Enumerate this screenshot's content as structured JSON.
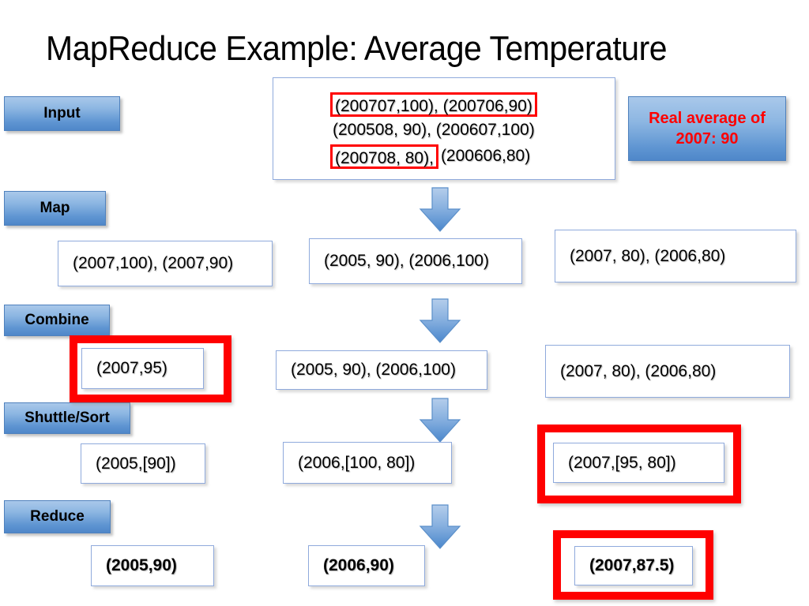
{
  "title": "MapReduce Example: Average Temperature",
  "callout": {
    "line1": "Real average of",
    "line2": "2007: 90",
    "text_color": "#ff0000",
    "fill_top": "#a9c8ea",
    "fill_bottom": "#4f87c9"
  },
  "stages": [
    {
      "id": "input",
      "label": "Input"
    },
    {
      "id": "map",
      "label": "Map"
    },
    {
      "id": "combine",
      "label": "Combine"
    },
    {
      "id": "shuttle_sort",
      "label": "Shuttle/Sort"
    },
    {
      "id": "reduce",
      "label": "Reduce"
    }
  ],
  "input_box": {
    "line1_highlighted": "(200707,100), (200706,90)",
    "line2": "(200508, 90), (200607,100)",
    "line3_highlighted": "(200708, 80),",
    "line3_rest": "(200606,80)"
  },
  "rows": {
    "map": {
      "left": "(2007,100), (2007,90)",
      "middle": "(2005, 90), (2006,100)",
      "right": "(2007, 80), (2006,80)"
    },
    "combine": {
      "left": "(2007,95)",
      "middle": "(2005, 90), (2006,100)",
      "right": "(2007, 80), (2006,80)"
    },
    "shuttle_sort": {
      "left": "(2005,[90])",
      "middle": "(2006,[100, 80])",
      "right": "(2007,[95, 80])"
    },
    "reduce": {
      "left": "(2005,90)",
      "middle": "(2006,90)",
      "right": "(2007,87.5)"
    }
  },
  "highlight_color": "#ff0000",
  "arrows": [
    {
      "id": "input-to-map"
    },
    {
      "id": "map-to-combine"
    },
    {
      "id": "combine-to-shuttle"
    },
    {
      "id": "shuttle-to-reduce"
    }
  ]
}
